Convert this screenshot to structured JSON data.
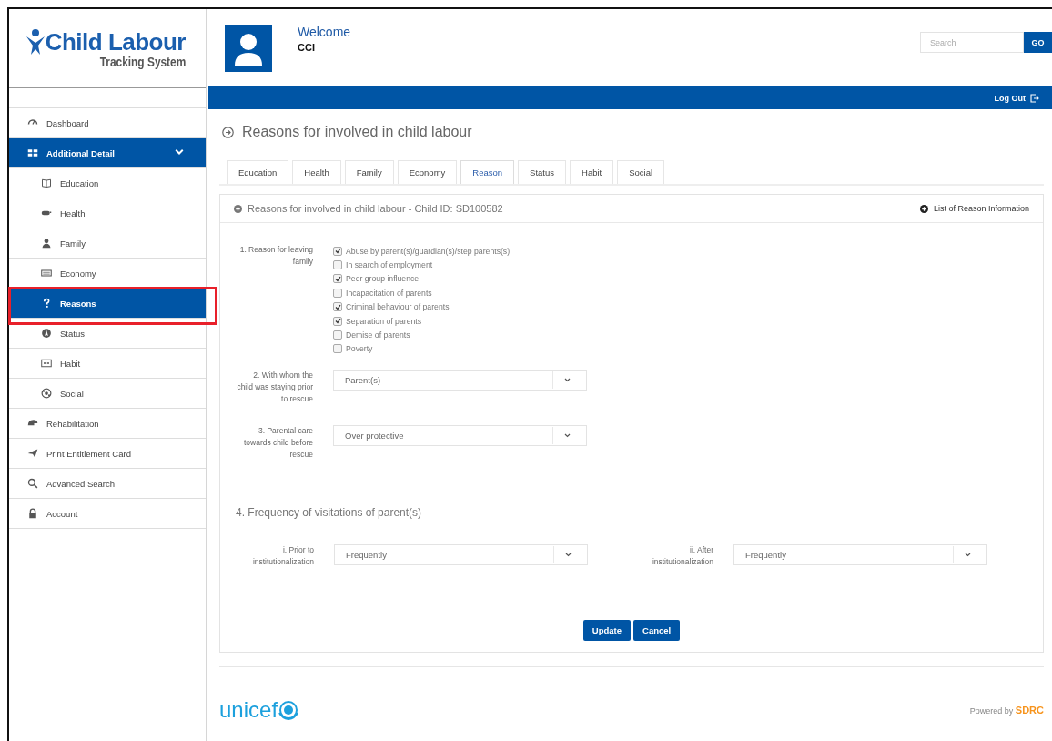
{
  "logo": {
    "title": "Child Labour",
    "subtitle": "Tracking System"
  },
  "user": {
    "greeting": "Welcome",
    "name": "CCI"
  },
  "search": {
    "placeholder": "Search",
    "button": "GO"
  },
  "topbar": {
    "logout": "Log Out"
  },
  "sidebar": {
    "items": [
      {
        "label": "Dashboard",
        "kind": "top",
        "selected": false
      },
      {
        "label": "Additional Detail",
        "kind": "top",
        "selected": true,
        "expanded": true
      },
      {
        "label": "Education",
        "kind": "sub",
        "selected": false
      },
      {
        "label": "Health",
        "kind": "sub",
        "selected": false
      },
      {
        "label": "Family",
        "kind": "sub",
        "selected": false
      },
      {
        "label": "Economy",
        "kind": "sub",
        "selected": false
      },
      {
        "label": "Reasons",
        "kind": "sub",
        "selected": true,
        "annotated": true
      },
      {
        "label": "Status",
        "kind": "sub",
        "selected": false
      },
      {
        "label": "Habit",
        "kind": "sub",
        "selected": false
      },
      {
        "label": "Social",
        "kind": "sub",
        "selected": false
      },
      {
        "label": "Rehabilitation",
        "kind": "top",
        "selected": false
      },
      {
        "label": "Print Entitlement Card",
        "kind": "top",
        "selected": false
      },
      {
        "label": "Advanced Search",
        "kind": "top",
        "selected": false
      },
      {
        "label": "Account",
        "kind": "top",
        "selected": false
      }
    ]
  },
  "page_title": "Reasons for involved in child labour",
  "tabs": [
    {
      "label": "Education",
      "selected": false
    },
    {
      "label": "Health",
      "selected": false
    },
    {
      "label": "Family",
      "selected": false
    },
    {
      "label": "Economy",
      "selected": false
    },
    {
      "label": "Reason",
      "selected": true
    },
    {
      "label": "Status",
      "selected": false
    },
    {
      "label": "Habit",
      "selected": false
    },
    {
      "label": "Social",
      "selected": false
    }
  ],
  "panel": {
    "title": "Reasons for involved in child labour - Child ID: SD100582",
    "link": "List of Reason Information"
  },
  "question_1": {
    "label": "1. Reason for leaving family",
    "options": [
      {
        "label": "Abuse by parent(s)/guardian(s)/step parents(s)",
        "checked": true
      },
      {
        "label": "In search of employment",
        "checked": false
      },
      {
        "label": "Peer group influence",
        "checked": true
      },
      {
        "label": "Incapacitation of parents",
        "checked": false
      },
      {
        "label": "Criminal behaviour of parents",
        "checked": true
      },
      {
        "label": "Separation of parents",
        "checked": true
      },
      {
        "label": "Demise of parents",
        "checked": false
      },
      {
        "label": "Poverty",
        "checked": false
      }
    ]
  },
  "question_2": {
    "label": "2. With whom the child was staying prior to rescue",
    "value": "Parent(s)"
  },
  "question_3": {
    "label": "3. Parental care towards child before rescue",
    "value": "Over protective"
  },
  "question_4": {
    "title": "4. Frequency of visitations of parent(s)",
    "fields": [
      {
        "label": "i. Prior to institutionalization",
        "value": "Frequently"
      },
      {
        "label": "ii. After institutionalization",
        "value": "Frequently"
      }
    ]
  },
  "buttons": [
    "Update",
    "Cancel"
  ],
  "footer": {
    "logo": "unicef",
    "powered": "Powered by **SDRC**"
  }
}
